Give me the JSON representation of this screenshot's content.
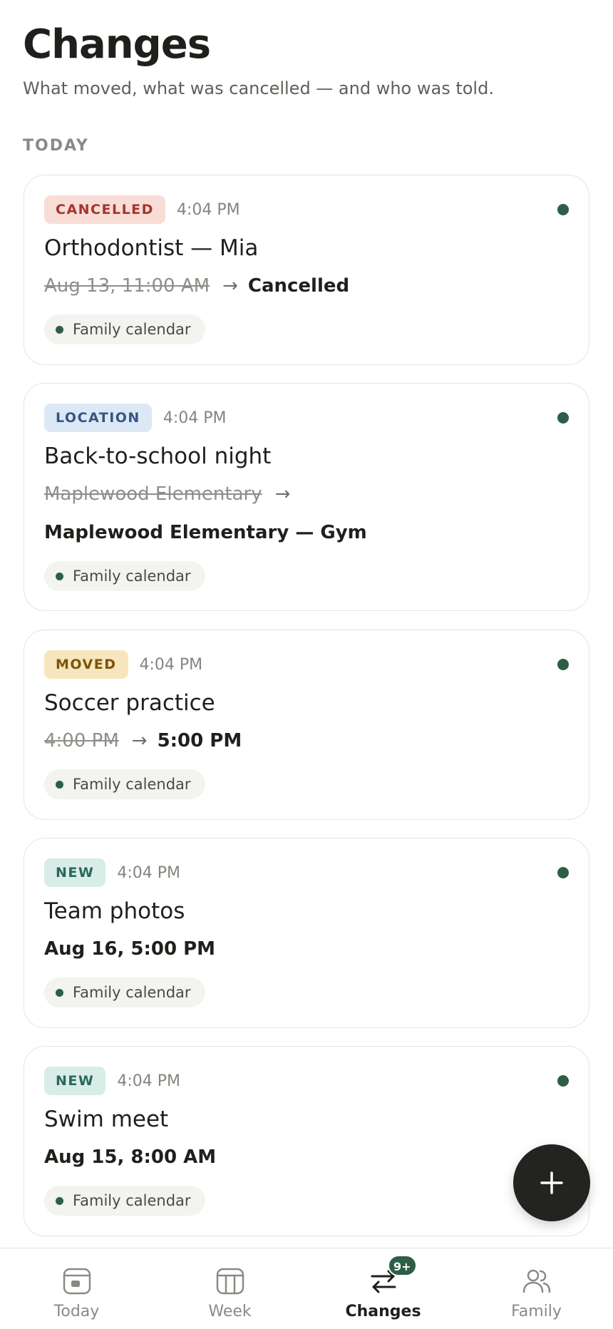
{
  "header": {
    "title": "Changes",
    "subtitle": "What moved, what was cancelled — and who was told."
  },
  "section": {
    "label": "TODAY"
  },
  "changes": [
    {
      "badge": "CANCELLED",
      "time": "4:04 PM",
      "title": "Orthodontist — Mia",
      "old_value": "Aug 13, 11:00 AM",
      "arrow": "→",
      "new_value": "Cancelled",
      "calendar": "Family calendar",
      "unread": true
    },
    {
      "badge": "LOCATION",
      "time": "4:04 PM",
      "title": "Back-to-school night",
      "old_value": "Maplewood Elementary",
      "arrow": "→",
      "new_value": "Maplewood Elementary — Gym",
      "calendar": "Family calendar",
      "unread": true
    },
    {
      "badge": "MOVED",
      "time": "4:04 PM",
      "title": "Soccer practice",
      "old_value": "4:00 PM",
      "arrow": "→",
      "new_value": "5:00 PM",
      "calendar": "Family calendar",
      "unread": true
    },
    {
      "badge": "NEW",
      "time": "4:04 PM",
      "title": "Team photos",
      "new_value": "Aug 16, 5:00 PM",
      "calendar": "Family calendar",
      "unread": true
    },
    {
      "badge": "NEW",
      "time": "4:04 PM",
      "title": "Swim meet",
      "new_value": "Aug 15, 8:00 AM",
      "calendar": "Family calendar",
      "unread": true
    }
  ],
  "fab": {
    "icon": "plus-icon"
  },
  "nav": {
    "items": [
      {
        "label": "Today",
        "icon": "today-icon",
        "active": false
      },
      {
        "label": "Week",
        "icon": "week-icon",
        "active": false
      },
      {
        "label": "Changes",
        "icon": "changes-icon",
        "active": true,
        "badge": "9+"
      },
      {
        "label": "Family",
        "icon": "family-icon",
        "active": false
      }
    ]
  },
  "colors": {
    "accent": "#2e5e47",
    "fab": "#23231f",
    "cancelled_bg": "#f8ddd7",
    "location_bg": "#dce8f5",
    "moved_bg": "#f7e6bd",
    "new_bg": "#d8ede8"
  }
}
